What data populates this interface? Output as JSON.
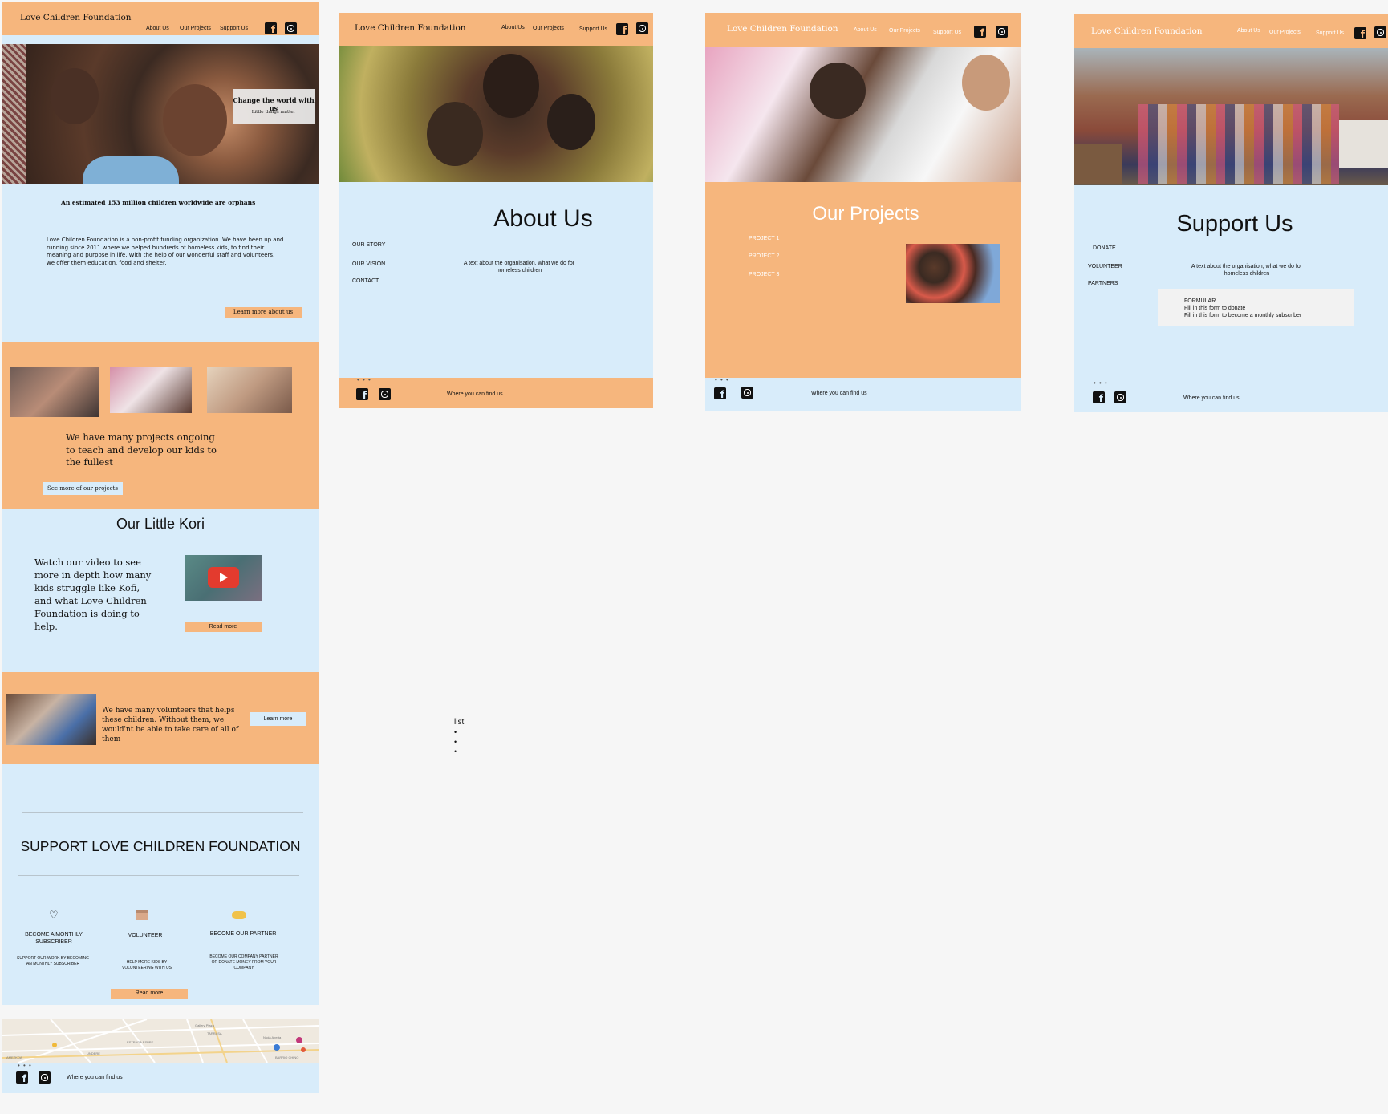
{
  "brand": "Love Children Foundation",
  "nav": {
    "about": "About Us",
    "projects": "Our Projects",
    "support": "Support Us"
  },
  "home": {
    "hero_title": "Change the world with us",
    "hero_subtitle": "Little things matter",
    "orphans_heading": "An estimated 153 million children worldwide are orphans",
    "intro_text": "Love Children Foundation is a non-profit funding organization. We have been up and running since 2011 where we helped hundreds of homeless kids, to find their meaning and purpose in life. With the help of our wonderful staff and volunteers, we offer them education, food and shelter.",
    "learn_more_about": "Learn more about us",
    "projects_text": "We have many projects ongoing to teach and develop our kids to the fullest",
    "see_more_projects": "See more of our projects",
    "kori_title": "Our Little Kori",
    "kori_text": "Watch our video to see more in depth how many kids struggle like Kofi, and what Love Children Foundation is doing to help.",
    "read_more": "Read more",
    "volunteers_text": "We have many volunteers that helps these children. Without them, we would'nt be able to take care of all of them",
    "learn_more": "Learn more",
    "support_title": "SUPPORT LOVE CHILDREN FOUNDATION",
    "support_items": [
      {
        "title": "BECOME A MONTHLY SUBSCRIBER",
        "desc": "SUPPORT OUR WORK BY BECOMING AN MONTHLY SUBSCRIBER"
      },
      {
        "title": "VOLUNTEER",
        "desc": "HELP MORE KIDS BY VOLUNTEERING WITH US"
      },
      {
        "title": "BECOME OUR PARTNER",
        "desc": "BECOME OUR COMPANY PARTNER OR DONATE MONEY FROM YOUR COMPANY"
      }
    ],
    "support_read_more": "Read more",
    "map_labels": [
      "AMEZKOA",
      "UNDERE",
      "ESTRADA ESPRE",
      "TARRASA",
      "Gallery Plaza",
      "Nuda Aberta",
      "BARRIO CHINO"
    ]
  },
  "about": {
    "title": "About Us",
    "menu": [
      "OUR STORY",
      "OUR VISION",
      "CONTACT"
    ],
    "text": "A text about the organisation, what we do for homeless children",
    "list_label": "list",
    "list_items": [
      "•",
      "•",
      "•"
    ]
  },
  "projects": {
    "title": "Our Projects",
    "items": [
      "PROJECT 1",
      "PROJECT 2",
      "PROJECT 3"
    ]
  },
  "support": {
    "title": "Support Us",
    "menu": [
      "DONATE",
      "VOLUNTEER",
      "PARTNERS"
    ],
    "text": "A text about the organisation, what we do for homeless children",
    "form_title": "FORMULAR",
    "form_line1": "Fill in this form to donate",
    "form_line2": "Fill in this form to become a monthly subscriber"
  },
  "footer": {
    "text": "Where you can find us",
    "dots": "• • •"
  },
  "colors": {
    "orange": "#f6b67d",
    "blue": "#d8ecfa",
    "canvas": "#f6f6f6",
    "youtube_red": "#e33b2e"
  },
  "icons": [
    "facebook-icon",
    "instagram-icon",
    "heart-icon",
    "box-icon",
    "handshake-icon",
    "play-icon"
  ]
}
